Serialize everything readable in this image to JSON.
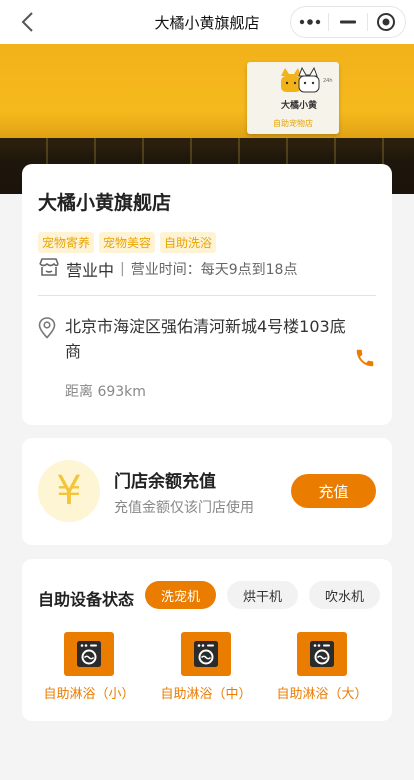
{
  "nav": {
    "title": "大橘小黄旗舰店",
    "back_icon": "back-arrow-icon",
    "more_icon": "more-dots-icon",
    "minimize_icon": "minimize-icon",
    "close_icon": "target-close-icon"
  },
  "hero": {
    "sign_name": "大橘小黄",
    "sign_sub": "自助宠物店",
    "sign_24": "24h"
  },
  "store": {
    "name": "大橘小黄旗舰店",
    "tags": [
      "宠物寄养",
      "宠物美容",
      "自助洗浴"
    ],
    "status": "营业中",
    "separator": "|",
    "hours": "营业时间：每天9点到18点",
    "address": "北京市海淀区强佑清河新城4号楼103底商",
    "distance": "距离 693km",
    "status_icon": "store-icon",
    "location_icon": "location-pin-icon",
    "phone_icon": "phone-icon"
  },
  "recharge": {
    "symbol": "¥",
    "title": "门店余额充值",
    "subtitle": "充值金额仅该门店使用",
    "button": "充值"
  },
  "devices": {
    "title": "自助设备状态",
    "tabs": [
      {
        "label": "洗宠机",
        "active": true
      },
      {
        "label": "烘干机",
        "active": false
      },
      {
        "label": "吹水机",
        "active": false
      }
    ],
    "items": [
      {
        "label": "自助淋浴（小）",
        "icon": "washer-icon"
      },
      {
        "label": "自助淋浴（中）",
        "icon": "washer-icon"
      },
      {
        "label": "自助淋浴（大）",
        "icon": "washer-icon"
      }
    ]
  },
  "colors": {
    "accent": "#ea7c00",
    "tag_bg": "#fff3d6",
    "tag_text": "#e8a400",
    "page_bg": "#f4f4f4"
  }
}
